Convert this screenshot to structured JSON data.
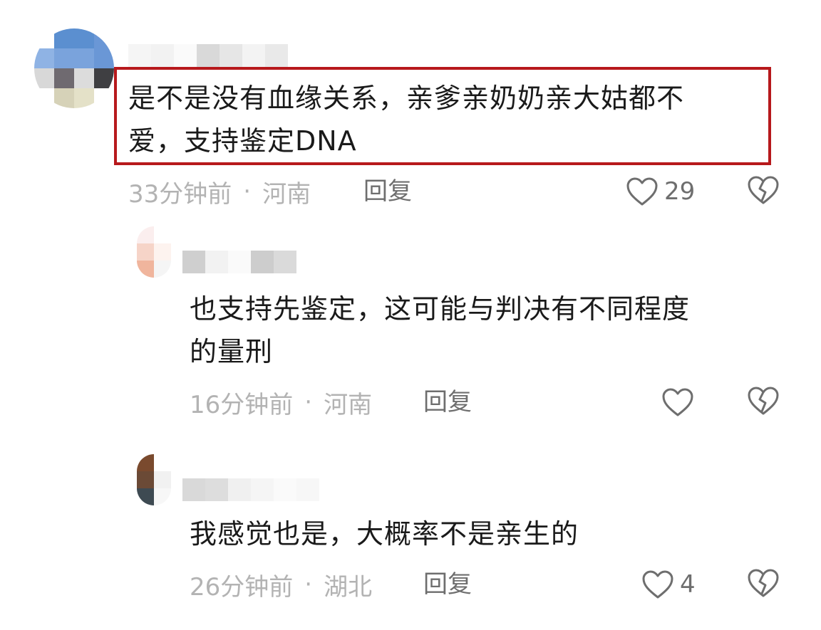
{
  "comments": [
    {
      "text": "是不是没有血缘关系，亲爹亲奶奶亲大姑都不爱，支持鉴定DNA",
      "line1": "是不是没有血缘关系，亲爹亲奶奶亲大姑都不",
      "line2": "爱，支持鉴定DNA",
      "time": "33分钟前",
      "location": "河南",
      "reply_label": "回复",
      "likes": "29",
      "highlighted": true
    },
    {
      "line1": "也支持先鉴定，这可能与判决有不同程度",
      "line2": "的量刑",
      "time": "16分钟前",
      "location": "河南",
      "reply_label": "回复",
      "likes": ""
    },
    {
      "line1": "我感觉也是，大概率不是亲生的",
      "time": "26分钟前",
      "location": "湖北",
      "reply_label": "回复",
      "likes": "4"
    }
  ],
  "meta_separator": "·",
  "colors": {
    "highlight_border": "#b7191c",
    "text": "#1a1a1a",
    "meta": "#b3b3b3",
    "action": "#6e6e6e"
  },
  "icons": {
    "like": "heart-outline-icon",
    "dislike": "broken-heart-icon"
  }
}
